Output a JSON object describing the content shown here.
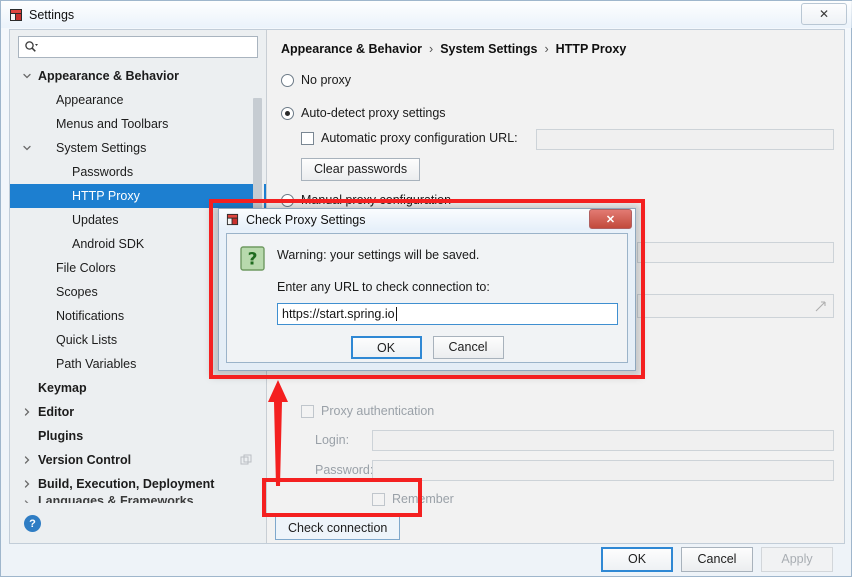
{
  "window": {
    "title": "Settings",
    "icon": "intellij-icon",
    "close_label": "✕"
  },
  "sidebar": {
    "search": {
      "placeholder": "",
      "value": "",
      "icon": "search-icon"
    },
    "help_icon": "?",
    "items": [
      {
        "label": "Appearance & Behavior",
        "level": 0,
        "bold": true,
        "twisty": "down",
        "selected": false
      },
      {
        "label": "Appearance",
        "level": 1,
        "bold": false,
        "twisty": "none",
        "selected": false
      },
      {
        "label": "Menus and Toolbars",
        "level": 1,
        "bold": false,
        "twisty": "none",
        "selected": false
      },
      {
        "label": "System Settings",
        "level": 1,
        "bold": false,
        "twisty": "down",
        "selected": false
      },
      {
        "label": "Passwords",
        "level": 2,
        "bold": false,
        "twisty": "none",
        "selected": false
      },
      {
        "label": "HTTP Proxy",
        "level": 2,
        "bold": false,
        "twisty": "none",
        "selected": true
      },
      {
        "label": "Updates",
        "level": 2,
        "bold": false,
        "twisty": "none",
        "selected": false
      },
      {
        "label": "Android SDK",
        "level": 2,
        "bold": false,
        "twisty": "none",
        "selected": false
      },
      {
        "label": "File Colors",
        "level": 1,
        "bold": false,
        "twisty": "none",
        "selected": false
      },
      {
        "label": "Scopes",
        "level": 1,
        "bold": false,
        "twisty": "none",
        "selected": false
      },
      {
        "label": "Notifications",
        "level": 1,
        "bold": false,
        "twisty": "none",
        "selected": false
      },
      {
        "label": "Quick Lists",
        "level": 1,
        "bold": false,
        "twisty": "none",
        "selected": false
      },
      {
        "label": "Path Variables",
        "level": 1,
        "bold": false,
        "twisty": "none",
        "selected": false
      },
      {
        "label": "Keymap",
        "level": 0,
        "bold": true,
        "twisty": "none",
        "selected": false
      },
      {
        "label": "Editor",
        "level": 0,
        "bold": true,
        "twisty": "right",
        "selected": false
      },
      {
        "label": "Plugins",
        "level": 0,
        "bold": true,
        "twisty": "none",
        "selected": false
      },
      {
        "label": "Version Control",
        "level": 0,
        "bold": true,
        "twisty": "right",
        "selected": false,
        "trailing_icon": "copy-icon"
      },
      {
        "label": "Build, Execution, Deployment",
        "level": 0,
        "bold": true,
        "twisty": "right",
        "selected": false
      },
      {
        "label": "Languages & Frameworks",
        "level": 0,
        "bold": true,
        "twisty": "right",
        "selected": false,
        "clipped": true
      }
    ]
  },
  "main": {
    "breadcrumb": [
      "Appearance & Behavior",
      "System Settings",
      "HTTP Proxy"
    ],
    "breadcrumb_separator": "›",
    "options": {
      "no_proxy": {
        "label": "No proxy",
        "selected": false
      },
      "auto_detect": {
        "label": "Auto-detect proxy settings",
        "selected": true
      },
      "auto_config_url": {
        "label": "Automatic proxy configuration URL:",
        "checked": false,
        "value": ""
      },
      "clear_passwords_button": "Clear passwords",
      "manual_config": {
        "label": "Manual proxy configuration",
        "selected": false
      }
    },
    "auth": {
      "proxy_authentication": {
        "label": "Proxy authentication",
        "checked": false
      },
      "login_label": "Login:",
      "login_value": "",
      "password_label": "Password:",
      "password_value": "",
      "remember": {
        "label": "Remember",
        "checked": false
      }
    },
    "check_connection_button": "Check connection"
  },
  "footer": {
    "ok": "OK",
    "cancel": "Cancel",
    "apply": "Apply"
  },
  "dialog": {
    "title": "Check Proxy Settings",
    "icon": "intellij-icon",
    "close_label": "✕",
    "warning": "Warning: your settings will be saved.",
    "prompt": "Enter any URL to check connection to:",
    "input_value": "https://start.spring.io",
    "input_placeholder": "",
    "ok": "OK",
    "cancel": "Cancel",
    "question_icon": "question-icon"
  },
  "annotations": {
    "highlight_color": "#f42020",
    "boxes": [
      "dialog-highlight",
      "check-connection-highlight"
    ],
    "arrow": "up-arrow"
  }
}
